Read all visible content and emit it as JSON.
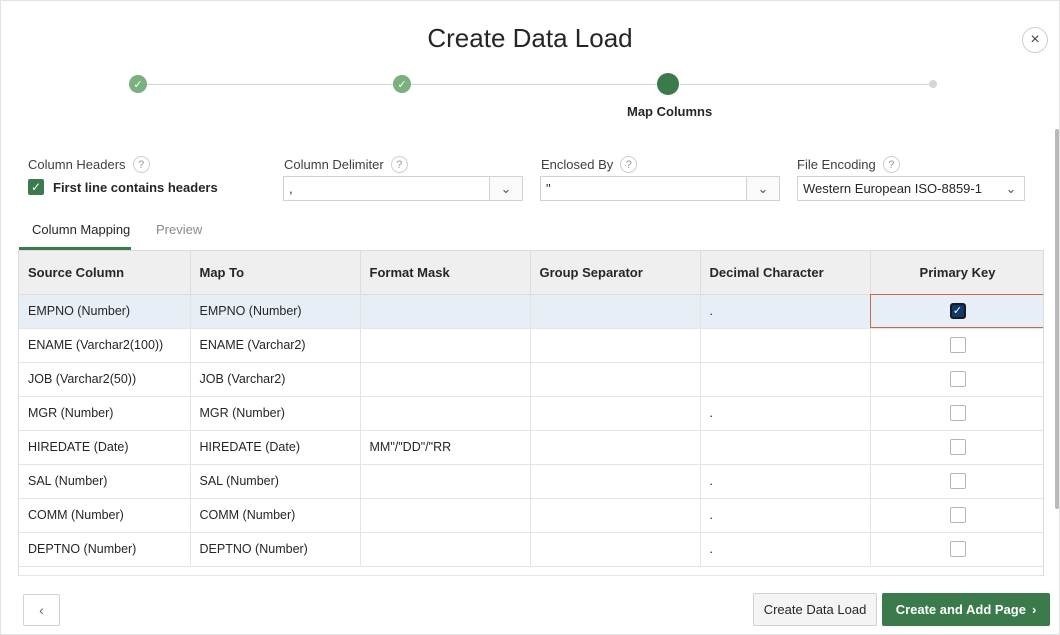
{
  "dialog": {
    "title": "Create Data Load",
    "close_icon": "×"
  },
  "wizard": {
    "current_step_label": "Map Columns",
    "done_icon": "✓"
  },
  "options": {
    "column_headers": {
      "label": "Column Headers",
      "checkbox_label": "First line contains headers",
      "checked": true
    },
    "column_delimiter": {
      "label": "Column Delimiter",
      "value": ","
    },
    "enclosed_by": {
      "label": "Enclosed By",
      "value": "\""
    },
    "file_encoding": {
      "label": "File Encoding",
      "value": "Western European ISO-8859-1"
    },
    "help_icon": "?"
  },
  "tabs": {
    "column_mapping": "Column Mapping",
    "preview": "Preview"
  },
  "table": {
    "headers": {
      "source_column": "Source Column",
      "map_to": "Map To",
      "format_mask": "Format Mask",
      "group_separator": "Group Separator",
      "decimal_character": "Decimal Character",
      "primary_key": "Primary Key"
    },
    "rows": [
      {
        "source": "EMPNO (Number)",
        "map_to": "EMPNO (Number)",
        "format_mask": "",
        "group_sep": "",
        "decimal": ".",
        "primary_key": true
      },
      {
        "source": "ENAME (Varchar2(100))",
        "map_to": "ENAME (Varchar2)",
        "format_mask": "",
        "group_sep": "",
        "decimal": "",
        "primary_key": false
      },
      {
        "source": "JOB (Varchar2(50))",
        "map_to": "JOB (Varchar2)",
        "format_mask": "",
        "group_sep": "",
        "decimal": "",
        "primary_key": false
      },
      {
        "source": "MGR (Number)",
        "map_to": "MGR (Number)",
        "format_mask": "",
        "group_sep": "",
        "decimal": ".",
        "primary_key": false
      },
      {
        "source": "HIREDATE (Date)",
        "map_to": "HIREDATE (Date)",
        "format_mask": "MM\"/\"DD\"/\"RR",
        "group_sep": "",
        "decimal": "",
        "primary_key": false
      },
      {
        "source": "SAL (Number)",
        "map_to": "SAL (Number)",
        "format_mask": "",
        "group_sep": "",
        "decimal": ".",
        "primary_key": false
      },
      {
        "source": "COMM (Number)",
        "map_to": "COMM (Number)",
        "format_mask": "",
        "group_sep": "",
        "decimal": ".",
        "primary_key": false
      },
      {
        "source": "DEPTNO (Number)",
        "map_to": "DEPTNO (Number)",
        "format_mask": "",
        "group_sep": "",
        "decimal": ".",
        "primary_key": false
      }
    ]
  },
  "footer": {
    "back_icon": "‹",
    "create_data_load": "Create Data Load",
    "create_and_add_page": "Create and Add Page",
    "next_icon": "›"
  },
  "colors": {
    "accent": "#3a7a4b",
    "step_done": "#7bb07f",
    "selected_row": "#e7eef6"
  }
}
